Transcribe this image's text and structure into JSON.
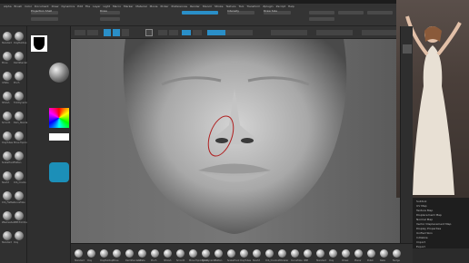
{
  "app": {
    "title": "ZBrush 2022",
    "menu": [
      "Alpha",
      "Brush",
      "Color",
      "Document",
      "Draw",
      "Dynamics",
      "Edit",
      "File",
      "Layer",
      "Light",
      "Macro",
      "Marker",
      "Material",
      "Movie",
      "Picker",
      "Preferences",
      "Render",
      "Stencil",
      "Stroke",
      "Texture",
      "Tool",
      "Transform",
      "Zplugin",
      "Zscript",
      "Help"
    ]
  },
  "topshelf": {
    "labels": [
      "Projection Shell",
      "Brush Fade",
      "Draw",
      "Focal Shift",
      "Intensity",
      "Draw Size",
      "Dynamic",
      "Backface Mask",
      "Double",
      "Morph Target",
      "Z Intensity"
    ]
  },
  "toolbar": {
    "edit_label": "Edit",
    "draw_label": "Draw",
    "move_label": "Move",
    "scale_label": "Scale",
    "rotate_label": "Rotate",
    "mrgb_label": "Mrgb",
    "rgb_label": "Rgb",
    "m_label": "M",
    "zadd_label": "Zadd",
    "zsub_label": "Zsub",
    "zcut_label": "Zcut",
    "rgb_intensity_label": "Rgb Intensity",
    "z_intensity_label": "Z Intensity 25",
    "focal_label": "Focal Shift 0",
    "size_label": "Draw Size 64",
    "dynamic_label": "Dynamic",
    "active_points_label": "ActivePoints: 1.732 Mil",
    "total_points_label": "TotalPoints: 1.732 Mil"
  },
  "leftpalette": {
    "brushes": [
      "Standard",
      "ClayBuildup",
      "Move",
      "DamStandard",
      "Inflate",
      "Pinch",
      "hPolish",
      "TrimDynamic",
      "Smooth",
      "Dam_Standard",
      "ClayTubes",
      "Move Topological",
      "SnakeHook",
      "Flatten",
      "Slash3",
      "Orb_Cracks",
      "Orb_Flatten",
      "CurveTube",
      "ZRemesher",
      "IMM Primitives",
      "Standard",
      "Clay"
    ]
  },
  "viewport": {
    "description_hint": ""
  },
  "rightmenu": {
    "items": [
      "Subtool",
      "UV Map",
      "Texture Map",
      "Displacement Map",
      "Normal Map",
      "Vector Displacement Map",
      "Display Properties",
      "Unified Skin",
      "Initialize",
      "Import",
      "Export"
    ]
  },
  "bottomshelf": {
    "items": [
      "Standard",
      "Clay",
      "ClayBuildup",
      "Move",
      "DamStandard",
      "Inflate",
      "Pinch",
      "hPolish",
      "Smooth",
      "Move Topological",
      "TrimDynamic",
      "Flatten",
      "SnakeHook",
      "ClayTubes",
      "Slash3",
      "Orb_Cracks",
      "ZModeler",
      "CurveTube",
      "IMM",
      "Standard",
      "Clay",
      "Chisel",
      "Planar",
      "Polish",
      "Rake",
      "Nudge"
    ]
  },
  "colors": {
    "accent_blue": "#2a8fc8",
    "highlight_orange": "#c87a2a",
    "red_marker": "#b02020"
  }
}
